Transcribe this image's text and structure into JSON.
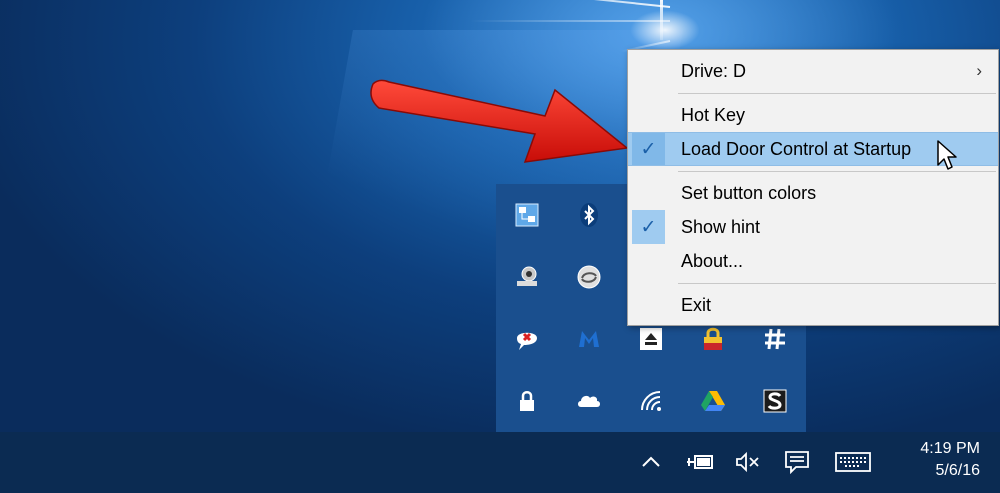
{
  "context_menu": {
    "items": [
      {
        "label": "Drive: D",
        "submenu": true,
        "checked": false
      },
      {
        "label": "Hot Key",
        "checked": false
      },
      {
        "label": "Load Door Control at Startup",
        "checked": true,
        "highlighted": true
      },
      {
        "label": "Set button colors",
        "checked": false
      },
      {
        "label": "Show hint",
        "checked": true
      },
      {
        "label": "About...",
        "checked": false
      },
      {
        "label": "Exit",
        "checked": false
      }
    ],
    "submenu_glyph": "›",
    "check_glyph": "✓"
  },
  "tray_overflow": {
    "icons": [
      "network-map-icon",
      "bluetooth-icon",
      "webcam-icon",
      "sync-app-icon",
      "speech-bubble-icon",
      "malwarebytes-icon",
      "eject-drive-icon",
      "password-lock-icon",
      "hashtag-icon",
      "lock-icon",
      "onedrive-icon",
      "wifi-icon",
      "google-drive-icon",
      "s-app-icon"
    ]
  },
  "taskbar": {
    "time": "4:19 PM",
    "date": "5/6/16",
    "icons": [
      "chevron-up-icon",
      "power-plug-icon",
      "volume-muted-icon",
      "action-center-icon",
      "keyboard-icon"
    ]
  },
  "colors": {
    "menu_highlight": "#9fcbf0",
    "taskbar": "#0b2b52",
    "tray_panel": "#1a4f8e",
    "arrow": "#e8130f"
  }
}
